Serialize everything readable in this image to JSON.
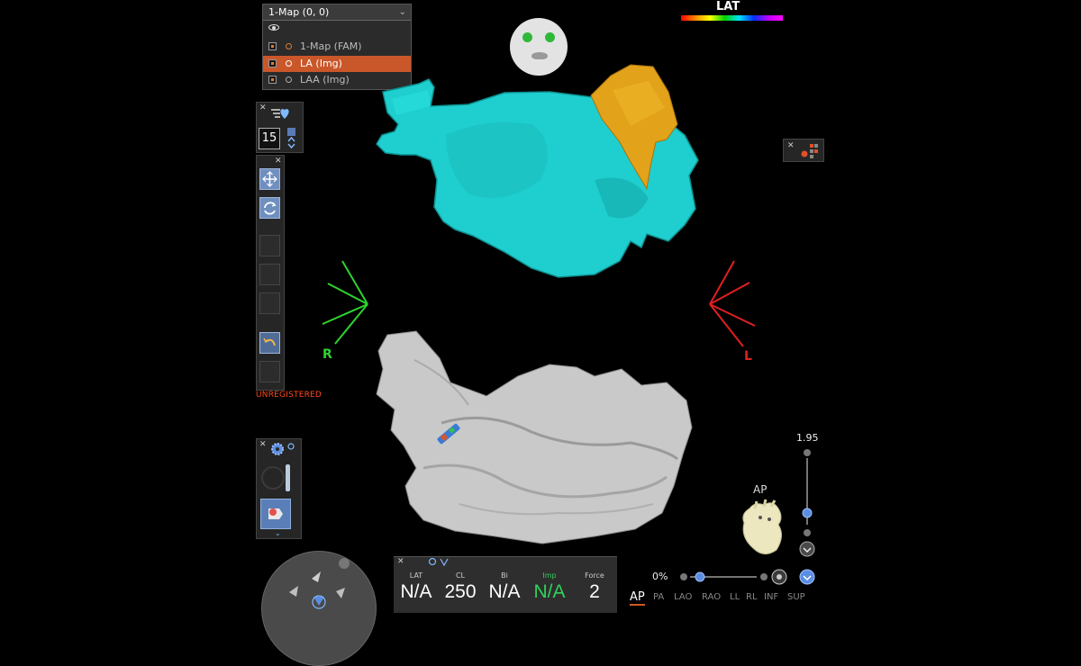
{
  "map_panel": {
    "selected": "1-Map (0, 0)",
    "items": [
      {
        "label": "1-Map (FAM)",
        "selected": false
      },
      {
        "label": "LA (Img)",
        "selected": true
      },
      {
        "label": "LAA (Img)",
        "selected": false
      }
    ]
  },
  "color_scale": {
    "title": "LAT"
  },
  "toolbar": {
    "number": "15",
    "status": "UNREGISTERED"
  },
  "orientation": {
    "right": "R",
    "left": "L",
    "view": "AP"
  },
  "zoom": {
    "value": "1.95",
    "percent": "0%"
  },
  "readout": [
    {
      "label": "LAT",
      "value": "N/A",
      "color": "#ffffff"
    },
    {
      "label": "CL",
      "value": "250",
      "color": "#ffffff"
    },
    {
      "label": "Bi",
      "value": "N/A",
      "color": "#ffffff"
    },
    {
      "label": "Imp",
      "value": "N/A",
      "color": "#2fd35a"
    },
    {
      "label": "Force",
      "value": "2",
      "color": "#ffffff"
    }
  ],
  "views": [
    "AP",
    "PA",
    "LAO",
    "RAO",
    "LL",
    "RL",
    "INF",
    "SUP"
  ],
  "colors": {
    "cyan_map": "#1fcfcf",
    "orange_region": "#e2a21a",
    "gray_model": "#c9c9c9",
    "accent": "#c9572a"
  }
}
